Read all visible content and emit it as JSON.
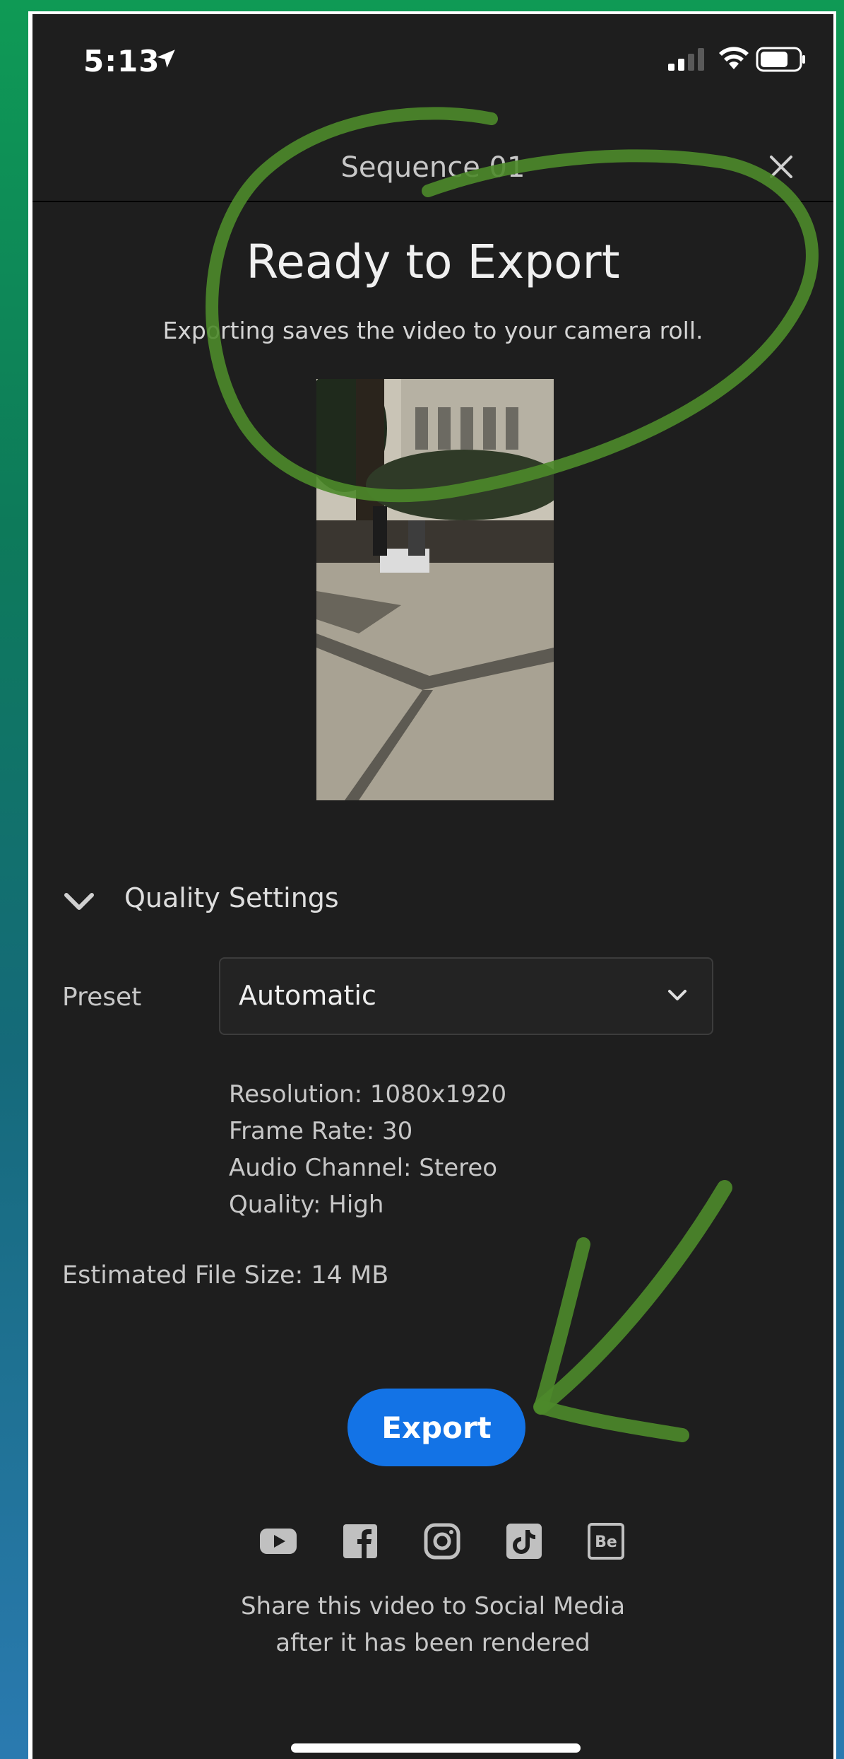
{
  "status_bar": {
    "time": "5:13"
  },
  "header": {
    "title": "Sequence 01"
  },
  "main": {
    "title": "Ready to Export",
    "subtitle": "Exporting saves the video to your camera roll."
  },
  "quality": {
    "section_label": "Quality Settings",
    "preset_label": "Preset",
    "preset_value": "Automatic",
    "specs": {
      "resolution": "Resolution: 1080x1920",
      "frame_rate": "Frame Rate: 30",
      "audio": "Audio Channel: Stereo",
      "quality": "Quality: High"
    },
    "file_size": "Estimated File Size: 14 MB"
  },
  "export_label": "Export",
  "social": {
    "icons": [
      "youtube-icon",
      "facebook-icon",
      "instagram-icon",
      "tiktok-icon",
      "behance-icon"
    ],
    "behance_text": "Be",
    "share_line1": "Share this video to Social Media",
    "share_line2": "after it has been rendered"
  },
  "colors": {
    "background": "#1e1e1e",
    "accent": "#1373e6",
    "annotation": "#4c8a2a"
  }
}
